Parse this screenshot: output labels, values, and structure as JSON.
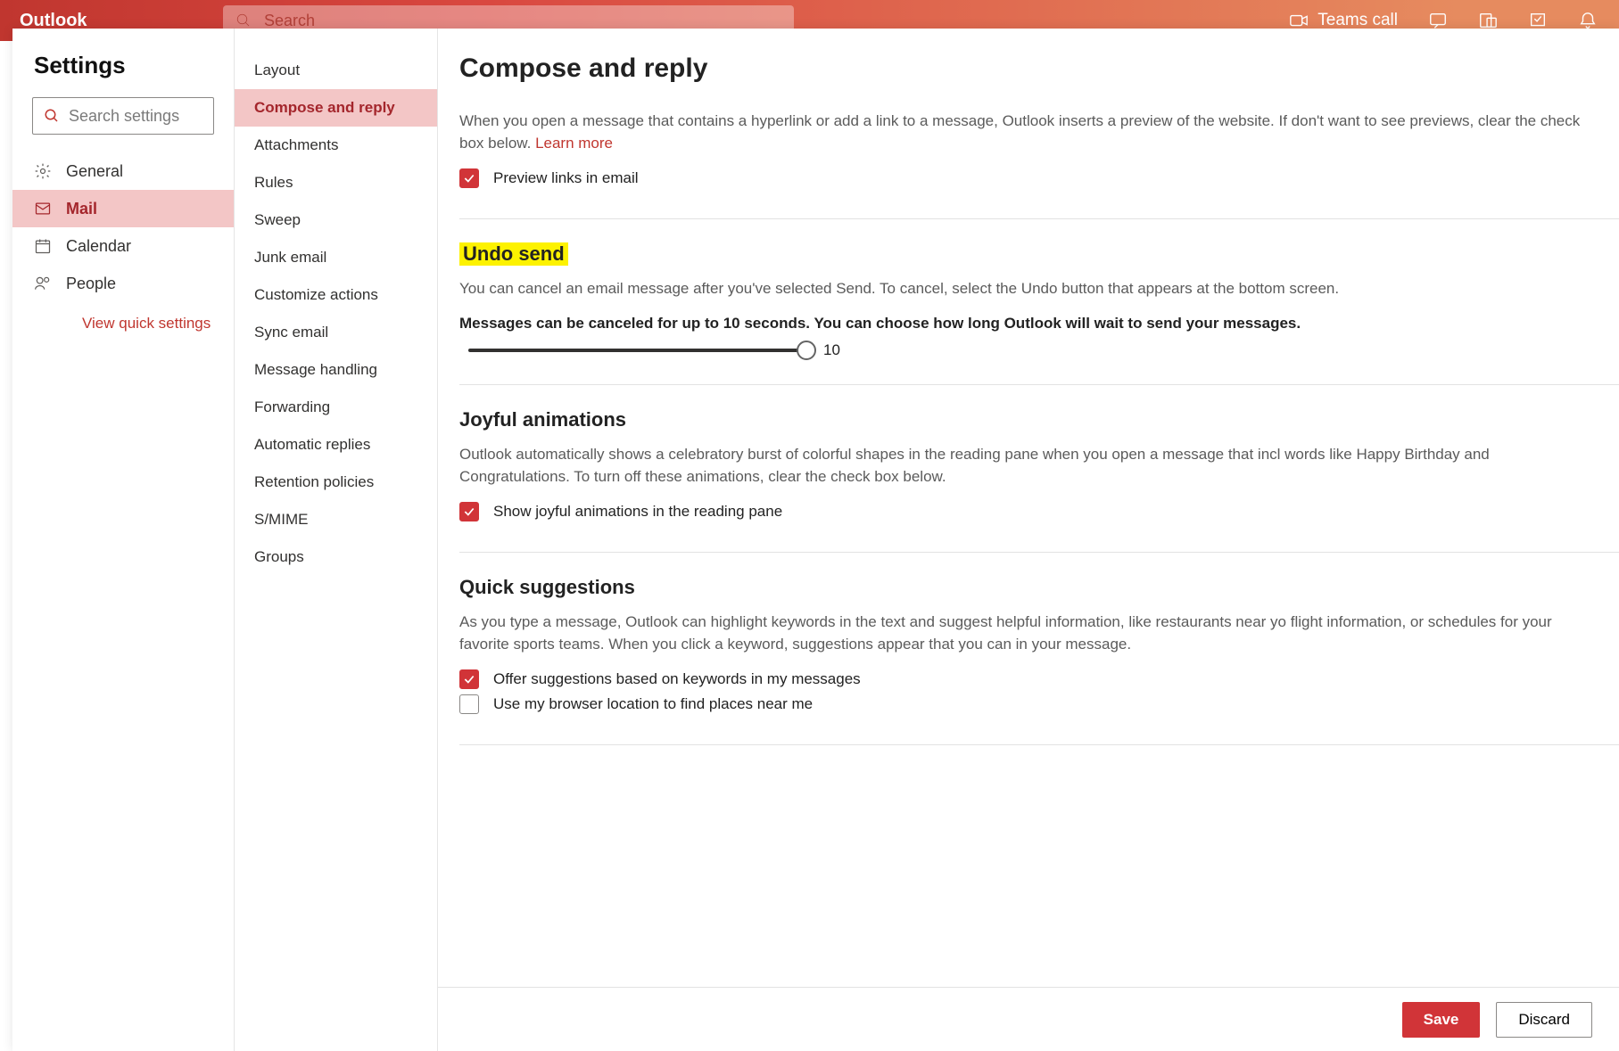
{
  "topbar": {
    "brand": "Outlook",
    "search_placeholder": "Search",
    "teams_call": "Teams call"
  },
  "col1": {
    "title": "Settings",
    "search_placeholder": "Search settings",
    "items": [
      {
        "label": "General",
        "active": false
      },
      {
        "label": "Mail",
        "active": true
      },
      {
        "label": "Calendar",
        "active": false
      },
      {
        "label": "People",
        "active": false
      }
    ],
    "quick_link": "View quick settings"
  },
  "col2": {
    "items": [
      {
        "label": "Layout",
        "active": false
      },
      {
        "label": "Compose and reply",
        "active": true
      },
      {
        "label": "Attachments",
        "active": false
      },
      {
        "label": "Rules",
        "active": false
      },
      {
        "label": "Sweep",
        "active": false
      },
      {
        "label": "Junk email",
        "active": false
      },
      {
        "label": "Customize actions",
        "active": false
      },
      {
        "label": "Sync email",
        "active": false
      },
      {
        "label": "Message handling",
        "active": false
      },
      {
        "label": "Forwarding",
        "active": false
      },
      {
        "label": "Automatic replies",
        "active": false
      },
      {
        "label": "Retention policies",
        "active": false
      },
      {
        "label": "S/MIME",
        "active": false
      },
      {
        "label": "Groups",
        "active": false
      }
    ]
  },
  "content": {
    "page_title": "Compose and reply",
    "link_preview": {
      "desc": "When you open a message that contains a hyperlink or add a link to a message, Outlook inserts a preview of the website. If don't want to see previews, clear the check box below. ",
      "learn_more": "Learn more",
      "checkbox_label": "Preview links in email",
      "checked": true
    },
    "undo_send": {
      "heading": "Undo send",
      "desc": "You can cancel an email message after you've selected Send. To cancel, select the Undo button that appears at the bottom screen.",
      "slider_label": "Messages can be canceled for up to 10 seconds. You can choose how long Outlook will wait to send your messages.",
      "slider_value": "10"
    },
    "joyful": {
      "heading": "Joyful animations",
      "desc": "Outlook automatically shows a celebratory burst of colorful shapes in the reading pane when you open a message that incl words like Happy Birthday and Congratulations. To turn off these animations, clear the check box below.",
      "checkbox_label": "Show joyful animations in the reading pane",
      "checked": true
    },
    "quick": {
      "heading": "Quick suggestions",
      "desc": "As you type a message, Outlook can highlight keywords in the text and suggest helpful information, like restaurants near yo flight information, or schedules for your favorite sports teams. When you click a keyword, suggestions appear that you can in your message.",
      "chk1_label": "Offer suggestions based on keywords in my messages",
      "chk1_checked": true,
      "chk2_label": "Use my browser location to find places near me",
      "chk2_checked": false
    },
    "footer": {
      "save_label": "Save",
      "discard_label": "Discard"
    }
  }
}
